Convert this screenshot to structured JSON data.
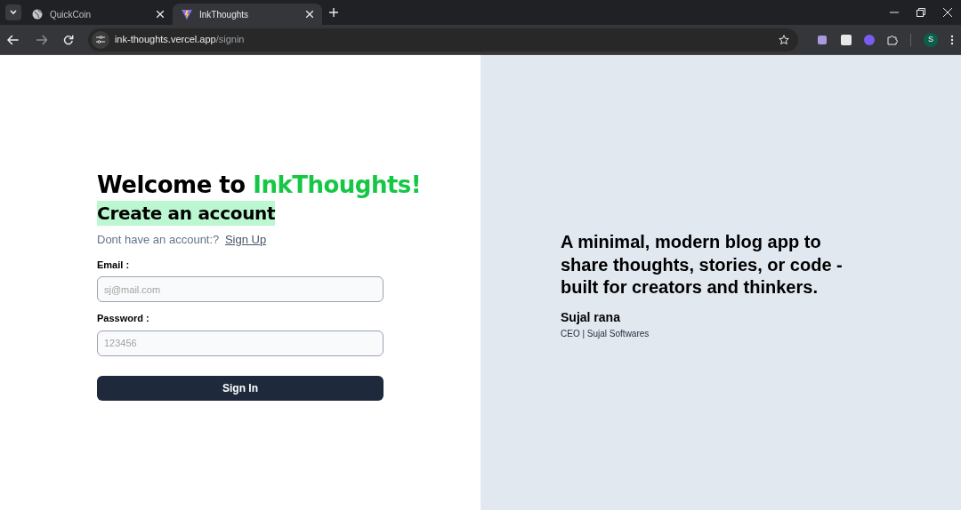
{
  "browser": {
    "tabs": [
      {
        "title": "QuickCoin",
        "selected": false,
        "kind": "globe"
      },
      {
        "title": "InkThoughts",
        "selected": true,
        "kind": "logo"
      }
    ],
    "address": {
      "host": "ink-thoughts.vercel.app",
      "path": "/signin"
    },
    "profile_initial": "S"
  },
  "signin": {
    "heading": [
      {
        "text": "Welcome to ",
        "kind": "plain"
      },
      {
        "text": "InkThoughts!",
        "kind": "brand"
      }
    ],
    "subheading": "Create an account",
    "prompt": "Dont have an account:?",
    "link": "Sign Up",
    "fields": [
      {
        "label": "Email :",
        "placeholder": "sj@mail.com"
      },
      {
        "label": "Password :",
        "placeholder": "123456"
      }
    ],
    "button": "Sign In"
  },
  "quote": {
    "text": "A minimal, modern blog app to share thoughts, stories, or code - built for creators and thinkers.",
    "author": "Sujal rana",
    "role": "CEO | Sujal Softwares"
  }
}
